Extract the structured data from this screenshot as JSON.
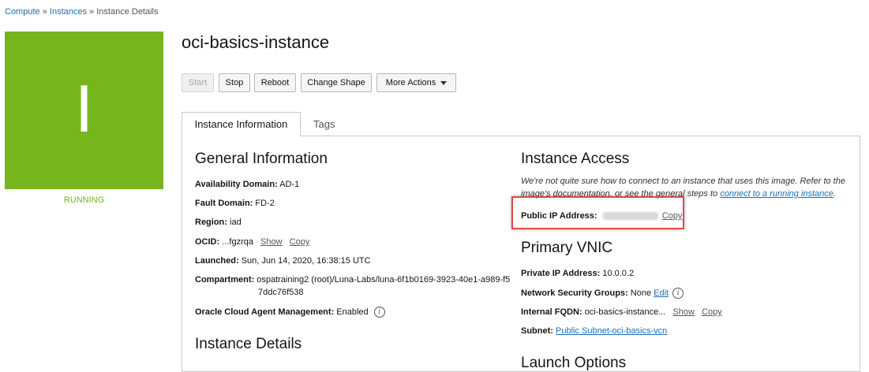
{
  "breadcrumb": {
    "items": [
      "Compute",
      "Instances",
      "Instance Details"
    ],
    "separator": "»"
  },
  "tile": {
    "letter": "I",
    "color": "#76b51b",
    "status": "RUNNING"
  },
  "title": "oci-basics-instance",
  "actions": {
    "start": "Start",
    "stop": "Stop",
    "reboot": "Reboot",
    "change_shape": "Change Shape",
    "more": "More Actions"
  },
  "tabs": {
    "active": "Instance Information",
    "other": "Tags"
  },
  "general": {
    "heading": "General Information",
    "ad_label": "Availability Domain:",
    "ad_value": "AD-1",
    "fd_label": "Fault Domain:",
    "fd_value": "FD-2",
    "region_label": "Region:",
    "region_value": "iad",
    "ocid_label": "OCID:",
    "ocid_value": "...fgzrqa",
    "show": "Show",
    "copy": "Copy",
    "launched_label": "Launched:",
    "launched_value": "Sun, Jun 14, 2020, 16:38:15 UTC",
    "compartment_label": "Compartment:",
    "compartment_value_1": "ospatraining2 (root)/Luna-Labs/luna-6f1b0169-3923-40e1-a989-f5",
    "compartment_value_2": "7ddc76f538",
    "agent_label": "Oracle Cloud Agent Management:",
    "agent_value": "Enabled"
  },
  "instance_details": {
    "heading": "Instance Details"
  },
  "access": {
    "heading": "Instance Access",
    "note_1": "We're not quite sure how to connect to an instance that uses this image. Refer to the",
    "note_2": "image's documentation, or see the general steps to",
    "note_link": "connect to a running instance",
    "note_end": ".",
    "public_ip_label": "Public IP Address:",
    "copy": "Copy"
  },
  "vnic": {
    "heading": "Primary VNIC",
    "private_ip_label": "Private IP Address:",
    "private_ip_value": "10.0.0.2",
    "nsg_label": "Network Security Groups:",
    "nsg_value": "None",
    "edit": "Edit",
    "fqdn_label": "Internal FQDN:",
    "fqdn_value": "oci-basics-instance...",
    "show": "Show",
    "copy": "Copy",
    "subnet_label": "Subnet:",
    "subnet_value": "Public Subnet-oci-basics-vcn"
  },
  "launch_options": {
    "heading": "Launch Options"
  }
}
